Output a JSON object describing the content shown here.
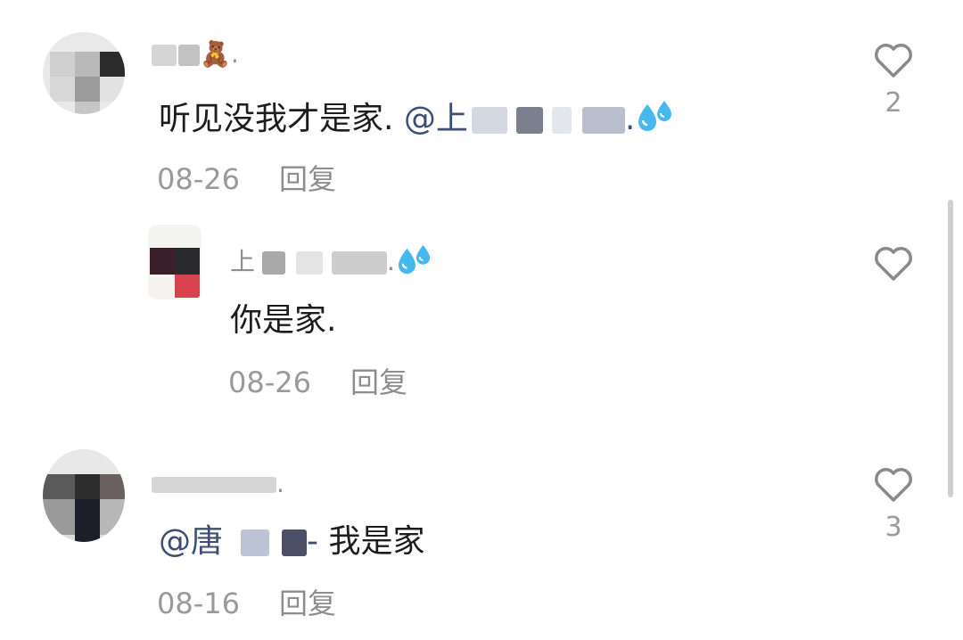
{
  "comments": [
    {
      "name_visible": "",
      "name_suffix": "🧸.",
      "text_prefix": "听见没我才是家. ",
      "mention_visible": "@上",
      "mention_suffix": ".",
      "date": "08-26",
      "reply_label": "回复",
      "likes": "2",
      "replies": [
        {
          "name_visible": "上",
          "name_suffix": ".",
          "text": "你是家.",
          "date": "08-26",
          "reply_label": "回复"
        }
      ]
    },
    {
      "name_visible": "",
      "name_suffix": ".",
      "mention_visible": "@唐",
      "mention_suffix": "-",
      "text_suffix": " 我是家",
      "date": "08-16",
      "reply_label": "回复",
      "likes": "3"
    }
  ],
  "icons": {
    "heart": "heart-outline-icon",
    "emoji_bear": "teddy-bear-emoji",
    "emoji_sweat": "sweat-droplets-emoji"
  },
  "colors": {
    "mention": "#3d4f73",
    "meta": "#9a9a9a"
  }
}
